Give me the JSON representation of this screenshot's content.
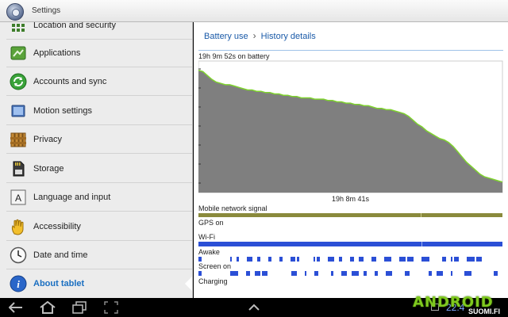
{
  "titlebar": {
    "title": "Settings",
    "icon": "settings-gear-icon"
  },
  "sidebar": {
    "items": [
      {
        "label": "Location and security",
        "icon": "location-grid-icon",
        "active": false
      },
      {
        "label": "Applications",
        "icon": "applications-icon",
        "active": false
      },
      {
        "label": "Accounts and sync",
        "icon": "sync-icon",
        "active": false
      },
      {
        "label": "Motion settings",
        "icon": "motion-icon",
        "active": false
      },
      {
        "label": "Privacy",
        "icon": "privacy-fence-icon",
        "active": false
      },
      {
        "label": "Storage",
        "icon": "sd-card-icon",
        "active": false
      },
      {
        "label": "Language and input",
        "icon": "keyboard-a-icon",
        "active": false
      },
      {
        "label": "Accessibility",
        "icon": "hand-icon",
        "active": false
      },
      {
        "label": "Date and time",
        "icon": "clock-icon",
        "active": false
      },
      {
        "label": "About tablet",
        "icon": "info-icon",
        "active": true
      }
    ]
  },
  "breadcrumb": {
    "parent": "Battery use",
    "current": "History details"
  },
  "battery": {
    "on_battery_text": "19h 9m 52s on battery",
    "duration_label": "19h 8m 41s",
    "level_curve": [
      93,
      92,
      89,
      86,
      84,
      83,
      82,
      82,
      81,
      80,
      79,
      78,
      78,
      77,
      77,
      76,
      76,
      75,
      75,
      74,
      74,
      73,
      73,
      72,
      72,
      72,
      71,
      71,
      71,
      70,
      70,
      69,
      69,
      68,
      68,
      67,
      67,
      66,
      66,
      65,
      64,
      64,
      63,
      63,
      62,
      61,
      60,
      58,
      55,
      52,
      50,
      47,
      45,
      43,
      41,
      40,
      38,
      35,
      31,
      27,
      23,
      20,
      17,
      14,
      12,
      11,
      10,
      9,
      8
    ],
    "fill_color": "#7f7f7f",
    "line_color": "#7fd32e"
  },
  "signals": [
    {
      "label": "Mobile network signal",
      "type": "solid",
      "color": "#8a8a3c",
      "coverage": 1.0
    },
    {
      "label": "GPS on",
      "type": "none",
      "color": "#2b4fd6"
    },
    {
      "label": "Wi-Fi",
      "type": "solid",
      "color": "#2b4fd6",
      "coverage": 1.0
    },
    {
      "label": "Awake",
      "type": "dashes",
      "color": "#2b4fd6",
      "density": 0.55
    },
    {
      "label": "Screen on",
      "type": "dashes",
      "color": "#2b4fd6",
      "density": 0.5
    },
    {
      "label": "Charging",
      "type": "none",
      "color": "#2b4fd6"
    }
  ],
  "navbar": {
    "back_icon": "back-arrow-icon",
    "home_icon": "home-icon",
    "recent_icon": "recent-apps-icon",
    "screenshot_icon": "screenshot-icon",
    "menu_up_icon": "chevron-up-icon",
    "clock": "22:4"
  },
  "watermark": {
    "line1": "ANDROID",
    "line2": "SUOMI.FI"
  }
}
